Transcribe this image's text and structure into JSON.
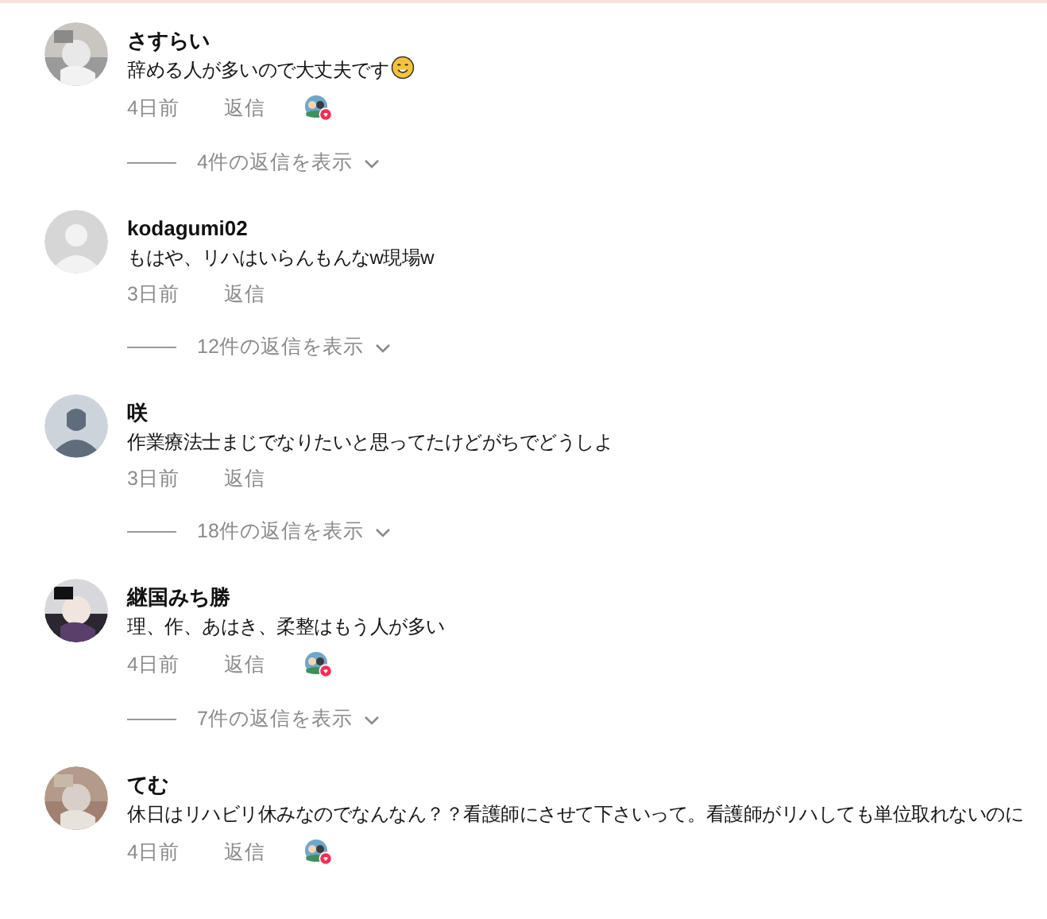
{
  "comments": [
    {
      "name": "さすらい",
      "text": "辞める人が多いので大丈夫です",
      "emoji": {
        "kind": "smile"
      },
      "time": "4日前",
      "reply": "返信",
      "creator_liked": true,
      "replies": "4件の返信を表示"
    },
    {
      "avatar": {
        "kind": "placeholder-light"
      },
      "name": "kodagumi02",
      "text": "もはや、リハはいらんもんなw現場w",
      "time": "3日前",
      "reply": "返信",
      "creator_liked": false,
      "replies": "12件の返信を表示"
    },
    {
      "avatar": {
        "kind": "placeholder-dark"
      },
      "name": "咲",
      "text": "作業療法士まじでなりたいと思ってたけどがちでどうしよ",
      "time": "3日前",
      "reply": "返信",
      "creator_liked": false,
      "replies": "18件の返信を表示"
    },
    {
      "name": "継国みち勝",
      "text": "理、作、あはき、柔整はもう人が多い",
      "time": "4日前",
      "reply": "返信",
      "creator_liked": true,
      "replies": "7件の返信を表示"
    },
    {
      "name": "てむ",
      "text": "休日はリハビリ休みなのでなんなん？？看護師にさせて下さいって。看護師がリハしても単位取れないのに",
      "time": "4日前",
      "reply": "返信",
      "creator_liked": true
    }
  ]
}
